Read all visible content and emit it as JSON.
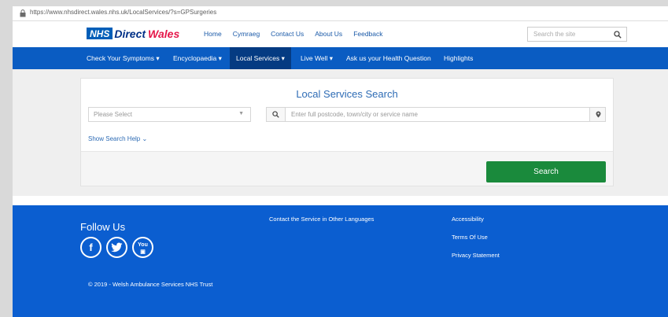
{
  "browser": {
    "url": "https://www.nhsdirect.wales.nhs.uk/LocalServices/?s=GPSurgeries"
  },
  "header": {
    "logo": {
      "nhs": "NHS",
      "direct": "Direct",
      "wales": "Wales"
    },
    "links": [
      "Home",
      "Cymraeg",
      "Contact Us",
      "About Us",
      "Feedback"
    ],
    "search_placeholder": "Search the site"
  },
  "nav": {
    "items": [
      "Check Your Symptoms",
      "Encyclopaedia",
      "Local Services",
      "Live Well",
      "Ask us your Health Question",
      "Highlights"
    ],
    "active": "Local Services"
  },
  "search_panel": {
    "title": "Local Services Search",
    "select_value": "Please Select",
    "location_placeholder": "Enter full postcode, town/city or service name",
    "help_link": "Show Search Help",
    "search_button": "Search"
  },
  "footer": {
    "follow_title": "Follow Us",
    "social": [
      "facebook-icon",
      "twitter-icon",
      "youtube-icon"
    ],
    "languages_link": "Contact the Service in Other Languages",
    "links": [
      "Accessibility",
      "Terms Of Use",
      "Privacy Statement"
    ],
    "copyright": "© 2019 - Welsh Ambulance Services NHS Trust"
  },
  "colors": {
    "nav_blue": "#0a5cc2",
    "nav_active": "#053b82",
    "footer_blue": "#0b5ed0",
    "search_green": "#1a8a3c",
    "brand_red": "#e5174a"
  }
}
